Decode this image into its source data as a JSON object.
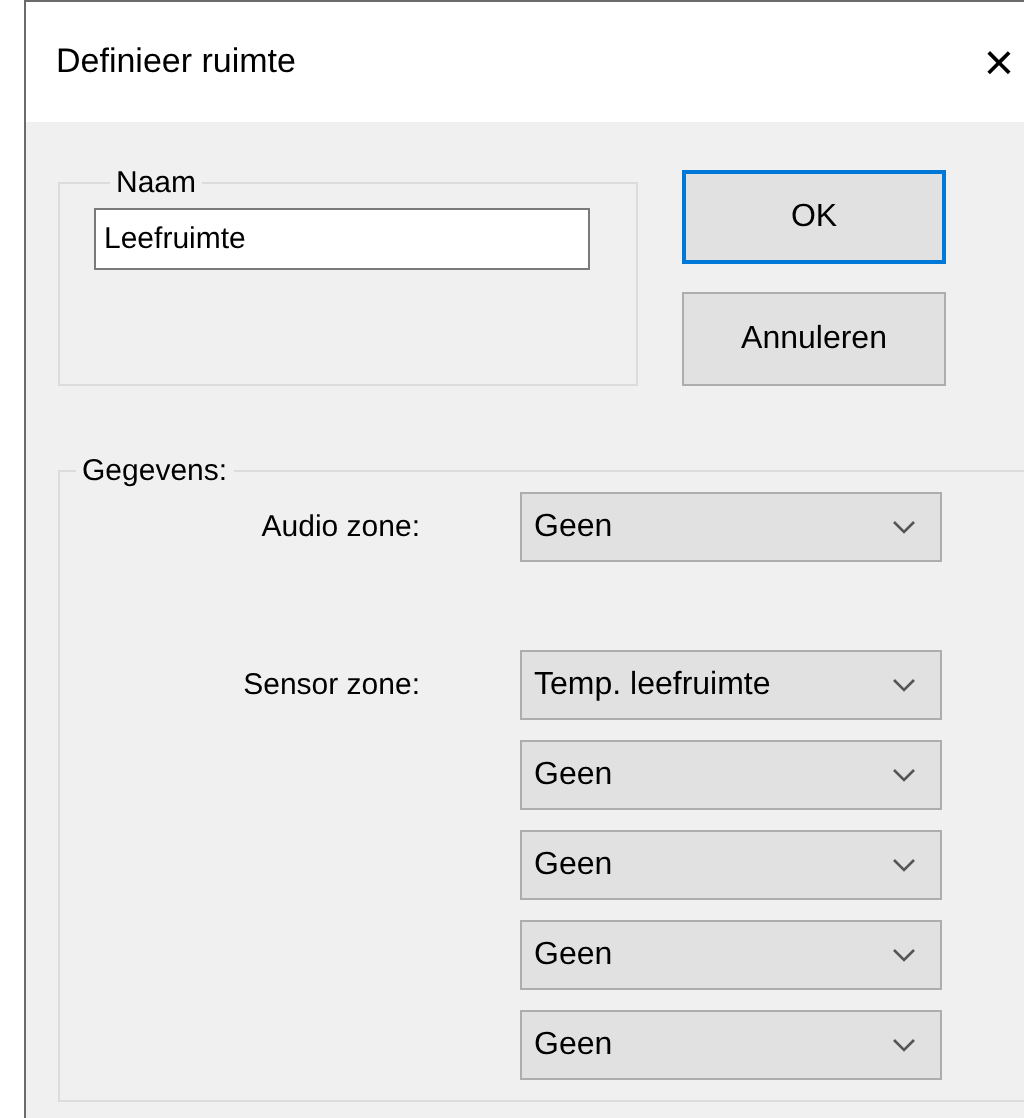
{
  "window": {
    "title": "Definieer ruimte",
    "close": "×"
  },
  "name_group": {
    "legend": "Naam",
    "value": "Leefruimte"
  },
  "buttons": [
    {
      "label": "OK",
      "focused": true
    },
    {
      "label": "Annuleren",
      "focused": false
    }
  ],
  "data_group": {
    "legend": "Gegevens:",
    "rows": [
      {
        "label": "Audio zone:",
        "selects": [
          "Geen"
        ]
      },
      {
        "label": "Sensor zone:",
        "selects": [
          "Temp. leefruimte",
          "Geen",
          "Geen",
          "Geen",
          "Geen"
        ]
      }
    ]
  }
}
